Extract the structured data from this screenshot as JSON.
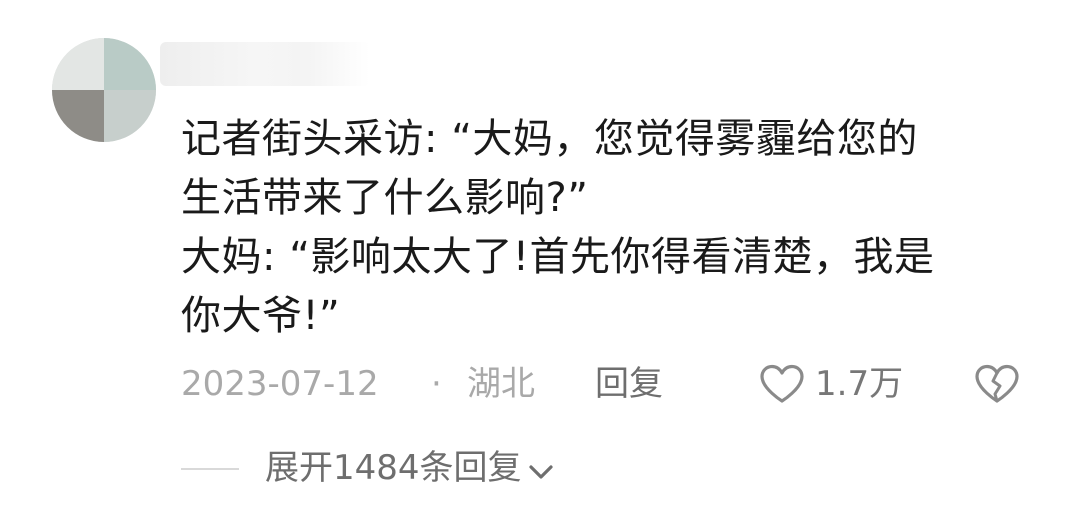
{
  "comment": {
    "lines": [
      "记者街头采访: “大妈，您觉得雾霾给您的",
      "生活带来了什么影响?”",
      "大妈: “影响太大了!首先你得看清楚，我是",
      "你大爷!”"
    ],
    "date": "2023-07-12",
    "separator": "·",
    "location": "湖北",
    "reply_label": "回复",
    "like_count": "1.7万",
    "expand_label": "展开1484条回复"
  },
  "icons": {
    "like": "heart-outline-icon",
    "dislike": "broken-heart-icon",
    "expand": "chevron-down-icon"
  },
  "colors": {
    "text": "#1a1a1a",
    "meta": "#a9a9a9",
    "action": "#6e6e6e"
  }
}
